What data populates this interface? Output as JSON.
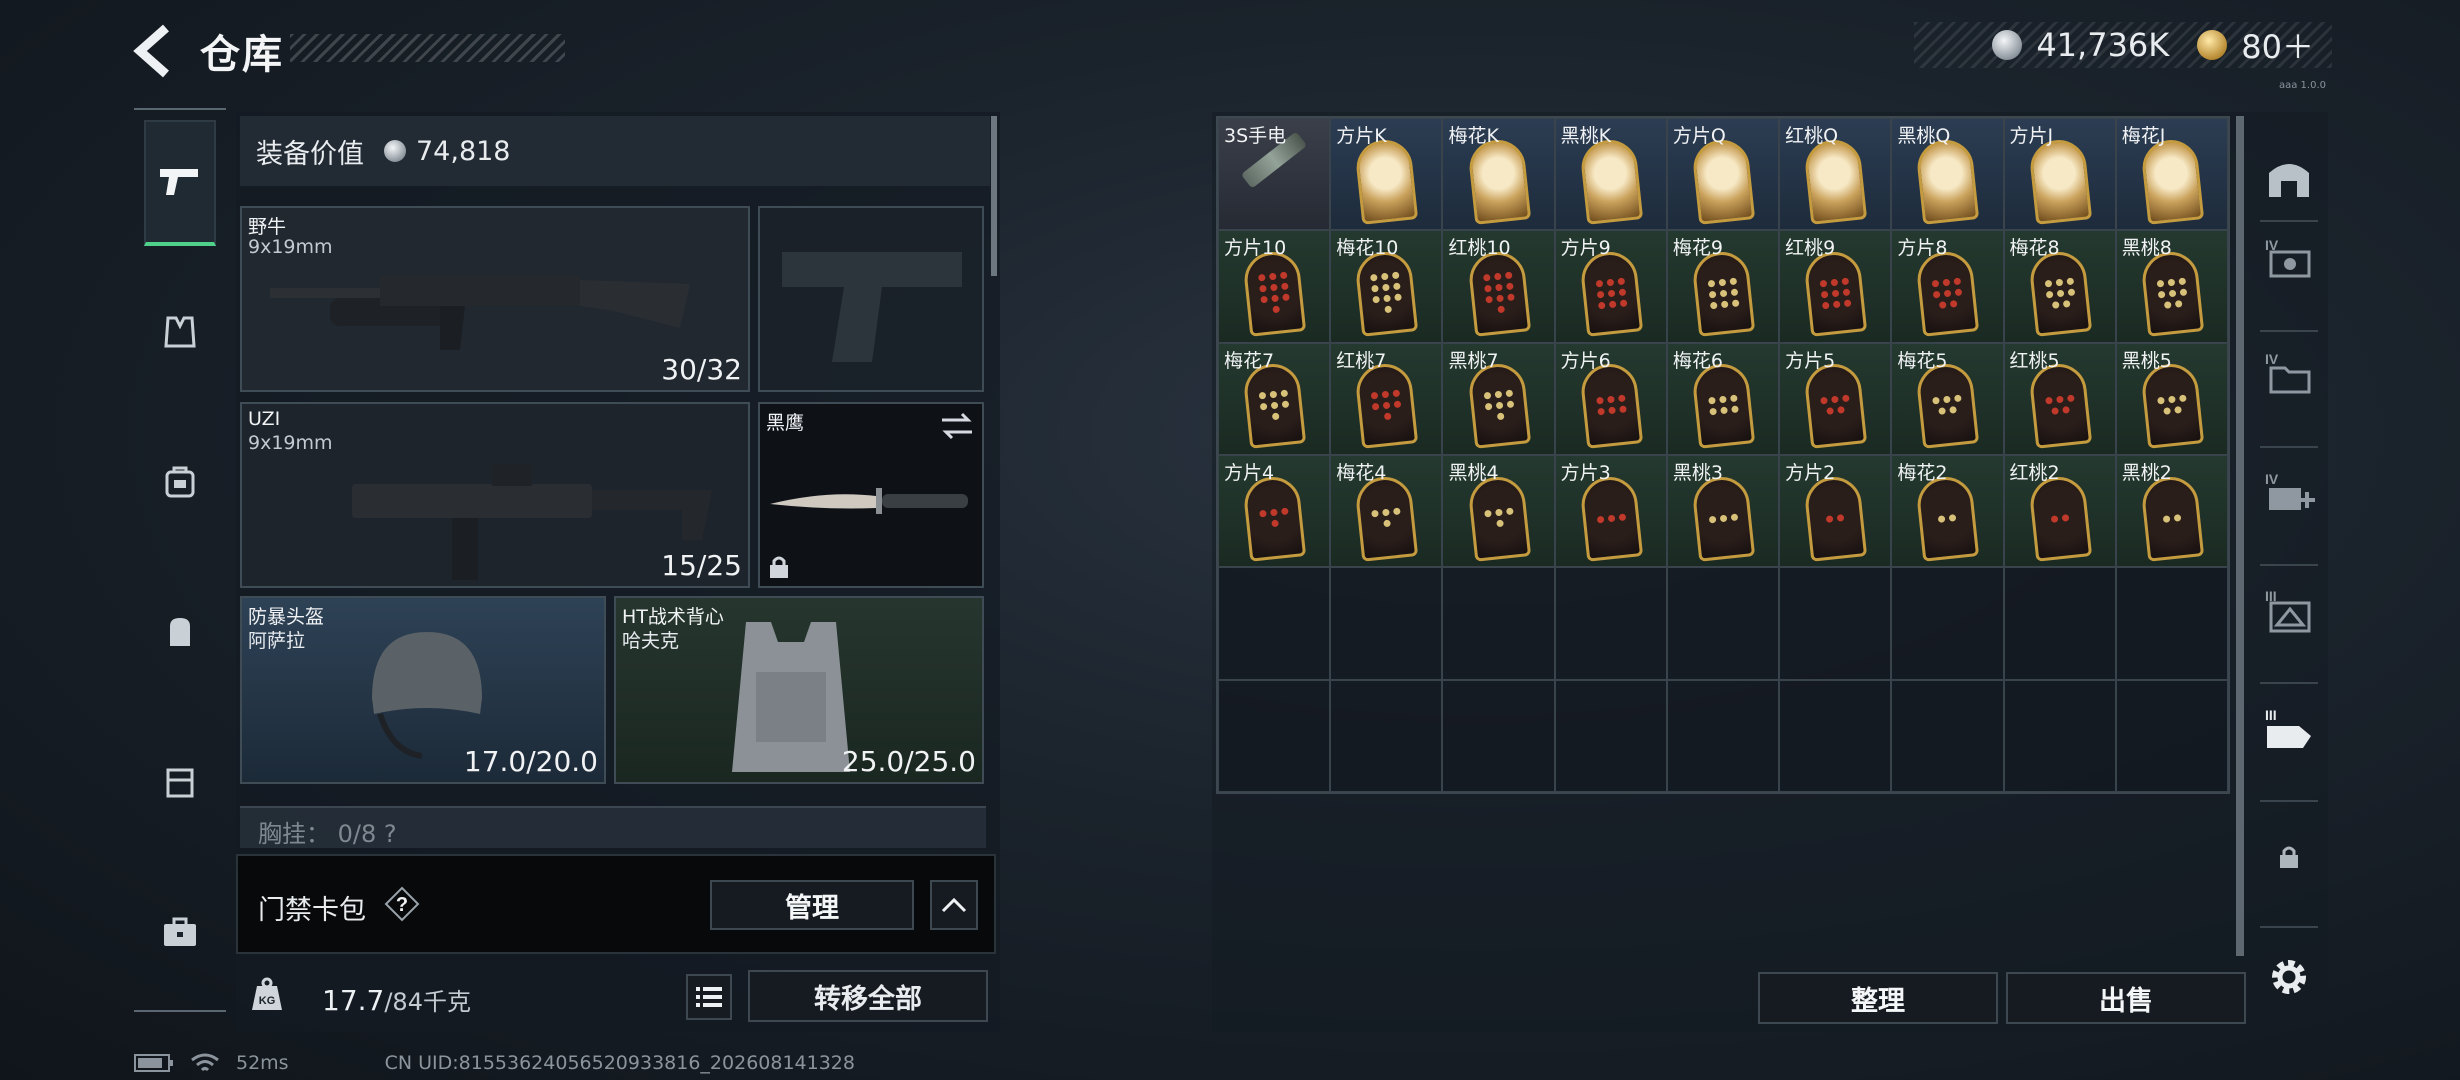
{
  "header": {
    "title": "仓库",
    "currency_silver": "41,736K",
    "currency_gold": "80＋",
    "version": "aaa 1.0.0"
  },
  "left_rail": {
    "items": [
      "pistol-icon",
      "armor-vest-icon",
      "rig-icon",
      "backpack-icon",
      "case-icon",
      "briefcase-icon"
    ],
    "active_index": 0
  },
  "loadout": {
    "equip_value_label": "装备价值",
    "equip_value": "74,818",
    "primary": {
      "name": "野牛",
      "caliber": "9x19mm",
      "ammo": "30/32"
    },
    "secondary": {
      "name": "UZI",
      "caliber": "9x19mm",
      "ammo": "15/25"
    },
    "melee": {
      "name": "黑鹰"
    },
    "helmet": {
      "name": "防暴头盔",
      "variant": "阿萨拉",
      "durability": "17.0/20.0"
    },
    "vest": {
      "name": "HT战术背心",
      "variant": "哈夫克",
      "durability": "25.0/25.0"
    },
    "partial_row": "胸挂： 0/8  ?",
    "card_pack": {
      "label": "门禁卡包",
      "help": "?",
      "manage_label": "管理"
    },
    "weight": {
      "value": "17.7",
      "max": "/84千克"
    },
    "transfer_all_label": "转移全部"
  },
  "storage": {
    "cells": [
      {
        "label": "3S手电",
        "type": "tool"
      },
      {
        "label": "方片K",
        "type": "face",
        "red": true
      },
      {
        "label": "梅花K",
        "type": "face",
        "red": false
      },
      {
        "label": "黑桃K",
        "type": "face",
        "red": false
      },
      {
        "label": "方片Q",
        "type": "face",
        "red": true
      },
      {
        "label": "红桃Q",
        "type": "face",
        "red": true
      },
      {
        "label": "黑桃Q",
        "type": "face",
        "red": false
      },
      {
        "label": "方片J",
        "type": "face",
        "red": true
      },
      {
        "label": "梅花J",
        "type": "face",
        "red": false
      },
      {
        "label": "方片10",
        "type": "pip",
        "red": true,
        "n": 10
      },
      {
        "label": "梅花10",
        "type": "pip",
        "red": false,
        "n": 10
      },
      {
        "label": "红桃10",
        "type": "pip",
        "red": true,
        "n": 10
      },
      {
        "label": "方片9",
        "type": "pip",
        "red": true,
        "n": 9
      },
      {
        "label": "梅花9",
        "type": "pip",
        "red": false,
        "n": 9
      },
      {
        "label": "红桃9",
        "type": "pip",
        "red": true,
        "n": 9
      },
      {
        "label": "方片8",
        "type": "pip",
        "red": true,
        "n": 8
      },
      {
        "label": "梅花8",
        "type": "pip",
        "red": false,
        "n": 8
      },
      {
        "label": "黑桃8",
        "type": "pip",
        "red": false,
        "n": 8
      },
      {
        "label": "梅花7",
        "type": "pip",
        "red": false,
        "n": 7
      },
      {
        "label": "红桃7",
        "type": "pip",
        "red": true,
        "n": 7
      },
      {
        "label": "黑桃7",
        "type": "pip",
        "red": false,
        "n": 7
      },
      {
        "label": "方片6",
        "type": "pip",
        "red": true,
        "n": 6
      },
      {
        "label": "梅花6",
        "type": "pip",
        "red": false,
        "n": 6
      },
      {
        "label": "方片5",
        "type": "pip",
        "red": true,
        "n": 5
      },
      {
        "label": "梅花5",
        "type": "pip",
        "red": false,
        "n": 5
      },
      {
        "label": "红桃5",
        "type": "pip",
        "red": true,
        "n": 5
      },
      {
        "label": "黑桃5",
        "type": "pip",
        "red": false,
        "n": 5
      },
      {
        "label": "方片4",
        "type": "pip",
        "red": true,
        "n": 4
      },
      {
        "label": "梅花4",
        "type": "pip",
        "red": false,
        "n": 4
      },
      {
        "label": "黑桃4",
        "type": "pip",
        "red": false,
        "n": 4
      },
      {
        "label": "方片3",
        "type": "pip",
        "red": true,
        "n": 3
      },
      {
        "label": "黑桃3",
        "type": "pip",
        "red": false,
        "n": 3
      },
      {
        "label": "方片2",
        "type": "pip",
        "red": true,
        "n": 2
      },
      {
        "label": "梅花2",
        "type": "pip",
        "red": false,
        "n": 2
      },
      {
        "label": "红桃2",
        "type": "pip",
        "red": true,
        "n": 2
      },
      {
        "label": "黑桃2",
        "type": "pip",
        "red": false,
        "n": 2
      }
    ],
    "empty_cells": 18,
    "sort_label": "整理",
    "sell_label": "出售"
  },
  "right_rail": {
    "items": [
      "warehouse-icon",
      "storage-iv-icon",
      "folder-iv-icon",
      "medkit-iv-icon",
      "storage-iii-icon",
      "hand-card-icon",
      "lock-icon",
      "settings-icon"
    ]
  },
  "status_bar": {
    "ping": "52ms",
    "uid": "CN UID:81553624056520933816_202608141328"
  },
  "colors": {
    "accent_green": "#4fd08b",
    "panel_bg": "#141b22",
    "card_gold": "#c59b3f",
    "pip_red": "#c0392b"
  }
}
